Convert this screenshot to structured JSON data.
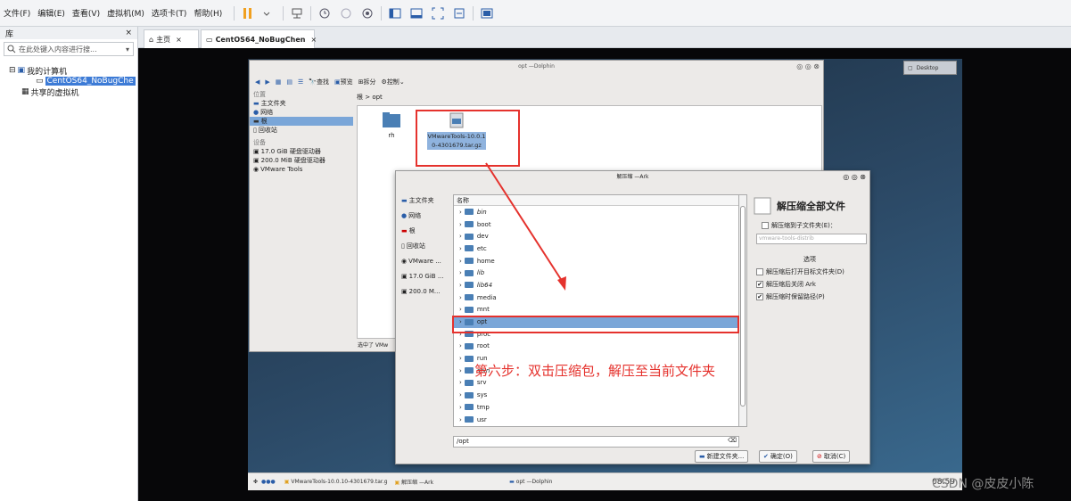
{
  "menu": [
    "文件(F)",
    "编辑(E)",
    "查看(V)",
    "虚拟机(M)",
    "选项卡(T)",
    "帮助(H)"
  ],
  "library": {
    "title": "库",
    "close": "×",
    "search_placeholder": "在此处键入内容进行搜...",
    "tree": {
      "my_computer": "我的计算机",
      "vm": "CentOS64_NoBugChe",
      "shared": "共享的虚拟机"
    }
  },
  "tabs": [
    {
      "label": "主页"
    },
    {
      "label": "CentOS64_NoBugChen"
    }
  ],
  "dolphin": {
    "title": "opt —Dolphin",
    "toolbar": [
      "查找",
      "预览",
      "拆分",
      "控制"
    ],
    "places_header": "位置",
    "places": [
      "主文件夹",
      "网络",
      "根",
      "回收站"
    ],
    "devices_header": "设备",
    "devices": [
      "17.0 GiB 硬盘驱动器",
      "200.0 MiB 硬盘驱动器",
      "VMware Tools"
    ],
    "breadcrumb": "根  >  opt",
    "files": [
      {
        "name": "rh"
      },
      {
        "name": "VMwareTools-10.0.10-4301679.tar.gz"
      }
    ],
    "status": "选中了 VMw"
  },
  "ark": {
    "title": "解压缩 —Ark",
    "places": [
      "主文件夹",
      "网络",
      "根",
      "回收站",
      "VMware ...",
      "17.0 GiB ...",
      "200.0 M..."
    ],
    "column": "名称",
    "folders": [
      "bin",
      "boot",
      "dev",
      "etc",
      "home",
      "lib",
      "lib64",
      "media",
      "mnt",
      "opt",
      "proc",
      "root",
      "run",
      "sbin",
      "srv",
      "sys",
      "tmp",
      "usr"
    ],
    "path": "/opt",
    "panel_title": "解压缩全部文件",
    "subfolder_label": "解压缩到子文件夹(E)：",
    "subfolder_value": "vmware-tools-distrib",
    "options_header": "选项",
    "opt1": "解压缩后打开目标文件夹(D)",
    "opt2": "解压缩后关闭 Ark",
    "opt3": "解压缩时保留路径(P)",
    "newfolder": "新建文件夹...",
    "ok": "确定(O)",
    "cancel": "取消(C)"
  },
  "annotation": "第六步：双击压缩包，解压至当前文件夹",
  "desktop_label": "Desktop",
  "taskbar": {
    "items": [
      "VMwareTools-10.0.10-4301679.tar.g",
      "解压缩 —Ark",
      "opt —Dolphin"
    ],
    "time": "08:59"
  },
  "watermark": "CSDN @皮皮小陈",
  "accent": "#e5322d"
}
